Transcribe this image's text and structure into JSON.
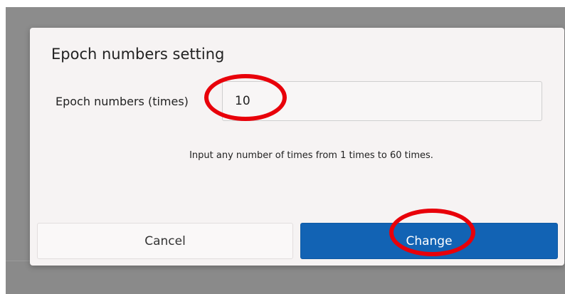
{
  "dialog": {
    "title": "Epoch numbers setting",
    "field_label": "Epoch numbers (times)",
    "field_value": "10",
    "hint": "Input any number of times from 1 times to 60 times.",
    "cancel_label": "Cancel",
    "change_label": "Change"
  },
  "colors": {
    "primary_button": "#1263b4",
    "annotation": "#e8000a",
    "dialog_background": "#f6f3f3",
    "backdrop": "#8c8c8c"
  },
  "annotations": [
    {
      "target": "epoch-numbers-input",
      "shape": "ellipse",
      "color": "#e8000a"
    },
    {
      "target": "change-button",
      "shape": "ellipse",
      "color": "#e8000a"
    }
  ]
}
